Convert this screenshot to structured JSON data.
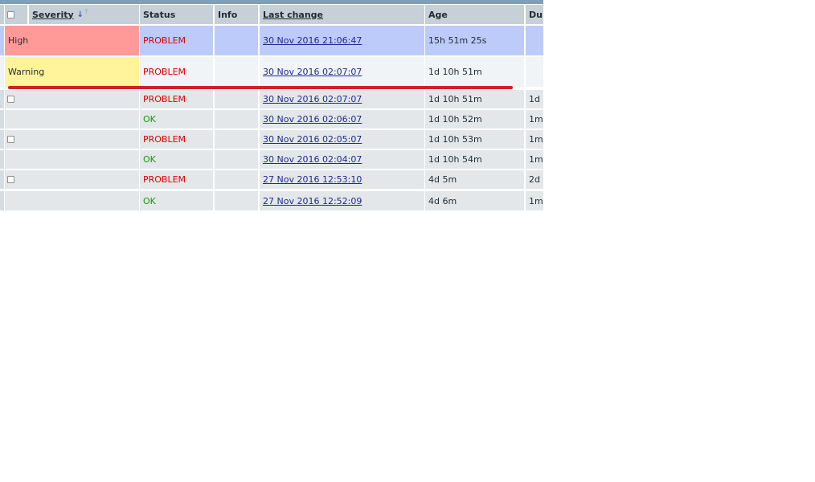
{
  "table": {
    "columns": {
      "severity": "Severity",
      "status": "Status",
      "info": "Info",
      "last_change": "Last change",
      "age": "Age",
      "duration": "Dur"
    },
    "rows": [
      {
        "severity": "High",
        "status": "PROBLEM",
        "last_change": "30 Nov 2016 21:06:47",
        "age": "15h 51m 25s",
        "duration": ""
      },
      {
        "severity": "Warning",
        "status": "PROBLEM",
        "last_change": "30 Nov 2016 02:07:07",
        "age": "1d 10h 51m",
        "duration": ""
      },
      {
        "severity": "",
        "status": "PROBLEM",
        "last_change": "30 Nov 2016 02:07:07",
        "age": "1d 10h 51m",
        "duration": "1d 1"
      },
      {
        "severity": "",
        "status": "OK",
        "last_change": "30 Nov 2016 02:06:07",
        "age": "1d 10h 52m",
        "duration": "1m"
      },
      {
        "severity": "",
        "status": "PROBLEM",
        "last_change": "30 Nov 2016 02:05:07",
        "age": "1d 10h 53m",
        "duration": "1m"
      },
      {
        "severity": "",
        "status": "OK",
        "last_change": "30 Nov 2016 02:04:07",
        "age": "1d 10h 54m",
        "duration": "1m"
      },
      {
        "severity": "",
        "status": "PROBLEM",
        "last_change": "27 Nov 2016 12:53:10",
        "age": "4d 5m",
        "duration": "2d 1"
      },
      {
        "severity": "",
        "status": "OK",
        "last_change": "27 Nov 2016 12:52:09",
        "age": "4d 6m",
        "duration": "1m"
      }
    ]
  },
  "colors": {
    "high": "#ff9a99",
    "warning": "#fff49b",
    "problem": "#dc0000",
    "ok": "#159b00",
    "selected_row": "#bccbf9",
    "annotation_line": "#d1202a"
  },
  "icons": {
    "sort": "arrow-down-icon",
    "checkbox": "checkbox-icon"
  }
}
